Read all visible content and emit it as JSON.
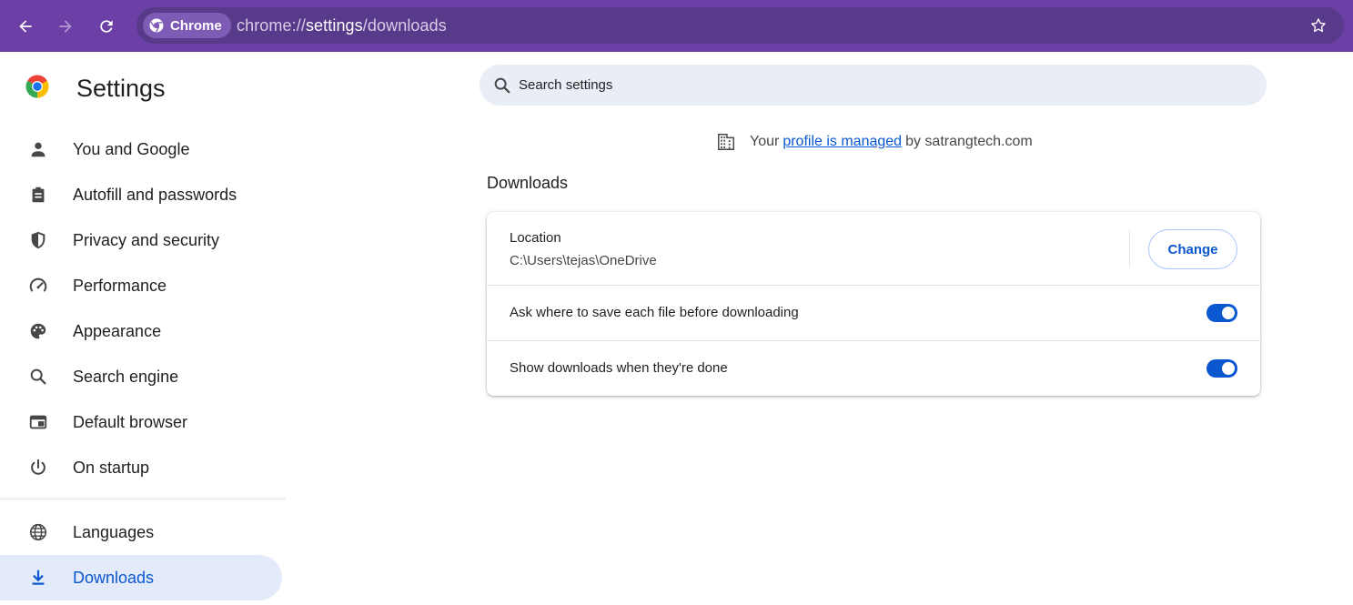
{
  "browser": {
    "chip_label": "Chrome",
    "url_scheme": "chrome://",
    "url_host": "settings",
    "url_path": "/downloads"
  },
  "sidebar": {
    "title": "Settings",
    "items": [
      {
        "label": "You and Google",
        "icon": "person-icon"
      },
      {
        "label": "Autofill and passwords",
        "icon": "clipboard-icon"
      },
      {
        "label": "Privacy and security",
        "icon": "shield-icon"
      },
      {
        "label": "Performance",
        "icon": "speedometer-icon"
      },
      {
        "label": "Appearance",
        "icon": "palette-icon"
      },
      {
        "label": "Search engine",
        "icon": "search-icon"
      },
      {
        "label": "Default browser",
        "icon": "browser-window-icon"
      },
      {
        "label": "On startup",
        "icon": "power-icon"
      },
      {
        "label": "Languages",
        "icon": "globe-icon"
      },
      {
        "label": "Downloads",
        "icon": "download-icon",
        "active": true
      }
    ]
  },
  "search": {
    "placeholder": "Search settings"
  },
  "managed": {
    "prefix": "Your",
    "link": "profile is managed",
    "suffix": "by satrangtech.com"
  },
  "downloads": {
    "section_title": "Downloads",
    "location_label": "Location",
    "location_path": "C:\\Users\\tejas\\OneDrive",
    "change_label": "Change",
    "ask_label": "Ask where to save each file before downloading",
    "ask_enabled": true,
    "show_label": "Show downloads when they're done",
    "show_enabled": true
  },
  "colors": {
    "toolbar": "#6b3fa6",
    "accent": "#0b57d0",
    "active_nav_bg": "#e3ebfa",
    "search_bg": "#e9eef6"
  }
}
